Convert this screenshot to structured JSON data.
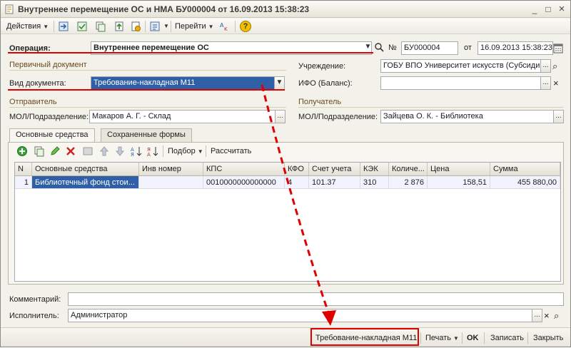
{
  "window": {
    "title": "Внутреннее перемещение ОС и НМА БУ000004 от 16.09.2013 15:38:23",
    "controls": {
      "minimize": "_",
      "maximize": "□",
      "close": "×"
    }
  },
  "toolbar": {
    "actions_label": "Действия",
    "goto_label": "Перейти",
    "help_label": "?"
  },
  "header": {
    "operation_label": "Операция:",
    "operation_value": "Внутреннее перемещение ОС",
    "number_label": "№",
    "number_value": "БУ000004",
    "date_label": "от",
    "date_value": "16.09.2013 15:38:23"
  },
  "primary_doc": {
    "section_title": "Первичный документ",
    "doc_type_label": "Вид документа:",
    "doc_type_value": "Требование-накладная М11",
    "institution_label": "Учреждение:",
    "institution_value": "ГОБУ ВПО Университет искусств (Субсидии)",
    "ifo_label": "ИФО (Баланс):",
    "ifo_value": ""
  },
  "sender": {
    "section_title": "Отправитель",
    "mol_label": "МОЛ/Подразделение:",
    "mol_value": "Макаров А. Г. - Склад"
  },
  "receiver": {
    "section_title": "Получатель",
    "mol_label": "МОЛ/Подразделение:",
    "mol_value": "Зайцева О. К. - Библиотека"
  },
  "tabs": [
    {
      "label": "Основные средства",
      "active": true
    },
    {
      "label": "Сохраненные формы",
      "active": false
    }
  ],
  "grid_toolbar": {
    "selection_label": "Подбор",
    "calculate_label": "Рассчитать"
  },
  "table": {
    "columns": [
      "N",
      "Основные средства",
      "Инв номер",
      "КПС",
      "КФО",
      "Счет учета",
      "КЭК",
      "Количе...",
      "Цена",
      "Сумма"
    ],
    "rows": [
      [
        "1",
        "Библиотечный фонд стои...",
        "",
        "0010000000000000",
        "4",
        "101.37",
        "310",
        "2 876",
        "158,51",
        "455 880,00"
      ]
    ]
  },
  "footer": {
    "comment_label": "Комментарий:",
    "comment_value": "",
    "executor_label": "Исполнитель:",
    "executor_value": "Администратор"
  },
  "bottom_bar": {
    "print_form_label": "Требование-накладная М11",
    "print_label": "Печать",
    "ok_label": "OK",
    "save_label": "Записать",
    "close_label": "Закрыть"
  },
  "colors": {
    "highlight": "#e00000",
    "selection": "#2f5fa7",
    "section_text": "#6b4b1e"
  }
}
